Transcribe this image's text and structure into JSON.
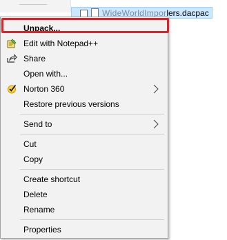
{
  "background": {
    "file_name_visible": "lers.dacpac",
    "file_name_obscured": "WideWorldImpor"
  },
  "menu": {
    "items": [
      {
        "label": "Unpack...",
        "icon": "none",
        "bold": true,
        "highlighted": true
      },
      {
        "label": "Edit with Notepad++",
        "icon": "notepad-plus-plus-icon"
      },
      {
        "label": "Share",
        "icon": "share-icon"
      },
      {
        "label": "Open with...",
        "icon": "none"
      },
      {
        "label": "Norton 360",
        "icon": "norton-check-icon",
        "submenu": true
      },
      {
        "label": "Restore previous versions",
        "icon": "none"
      },
      {
        "label": "Send to",
        "icon": "none",
        "submenu": true
      },
      {
        "label": "Cut",
        "icon": "none"
      },
      {
        "label": "Copy",
        "icon": "none"
      },
      {
        "label": "Create shortcut",
        "icon": "none"
      },
      {
        "label": "Delete",
        "icon": "none"
      },
      {
        "label": "Rename",
        "icon": "none"
      },
      {
        "label": "Properties",
        "icon": "none"
      }
    ]
  },
  "colors": {
    "highlight_border": "#d9242a",
    "menu_bg": "#f2f2f2",
    "selection_bg": "#cce8ff"
  }
}
